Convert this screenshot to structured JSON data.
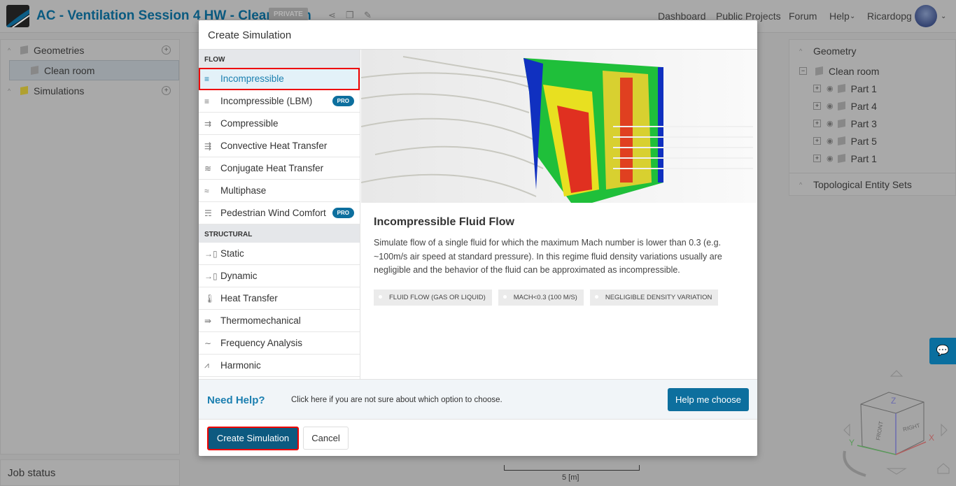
{
  "header": {
    "title": "AC - Ventilation Session 4 HW - Clean room",
    "private": "PRIVATE",
    "nav": [
      "Dashboard",
      "Public Projects",
      "Forum",
      "Help",
      "Ricardopg"
    ]
  },
  "left": {
    "geometries": "Geometries",
    "clean_room": "Clean room",
    "simulations": "Simulations",
    "job_status": "Job status"
  },
  "right": {
    "geometry": "Geometry",
    "root": "Clean room",
    "parts": [
      "Part 1",
      "Part 4",
      "Part 3",
      "Part 5",
      "Part 1"
    ],
    "topo": "Topological Entity Sets"
  },
  "modal": {
    "title": "Create Simulation",
    "flow_label": "FLOW",
    "flow": [
      {
        "label": "Incompressible",
        "icon": "≡"
      },
      {
        "label": "Incompressible (LBM)",
        "icon": "≡",
        "pro": "PRO"
      },
      {
        "label": "Compressible",
        "icon": "⇉"
      },
      {
        "label": "Convective Heat Transfer",
        "icon": "⇶"
      },
      {
        "label": "Conjugate Heat Transfer",
        "icon": "≋"
      },
      {
        "label": "Multiphase",
        "icon": "≈"
      },
      {
        "label": "Pedestrian Wind Comfort",
        "icon": "☴",
        "pro": "PRO"
      }
    ],
    "structural_label": "STRUCTURAL",
    "structural": [
      {
        "label": "Static",
        "icon": "→▯"
      },
      {
        "label": "Dynamic",
        "icon": "→▯"
      },
      {
        "label": "Heat Transfer",
        "icon": "🌡"
      },
      {
        "label": "Thermomechanical",
        "icon": "⇛"
      },
      {
        "label": "Frequency Analysis",
        "icon": "∼"
      },
      {
        "label": "Harmonic",
        "icon": "⩘"
      }
    ],
    "detail_title": "Incompressible Fluid Flow",
    "detail_text": "Simulate flow of a single fluid for which the maximum Mach number is lower than 0.3 (e.g. ~100m/s air speed at standard pressure). In this regime fluid density variations usually are negligible and the behavior of the fluid can be approximated as incompressible.",
    "tags": [
      "FLUID FLOW (GAS OR LIQUID)",
      "MACH<0.3 (100 M/S)",
      "NEGLIGIBLE DENSITY VARIATION"
    ],
    "need_help": "Need Help?",
    "help_text": "Click here if you are not sure about which option to choose.",
    "help_button": "Help me choose",
    "create": "Create Simulation",
    "cancel": "Cancel"
  },
  "viewer": {
    "scale": "5 [m]",
    "front": "FRONT",
    "right": "RIGHT",
    "x": "X",
    "y": "Y",
    "z": "Z"
  }
}
